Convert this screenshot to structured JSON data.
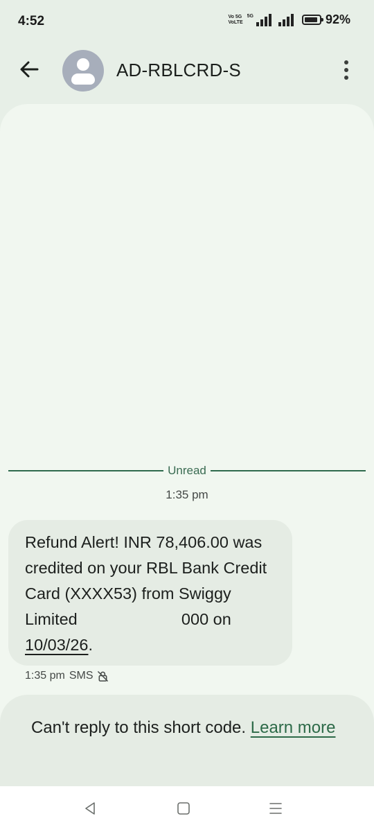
{
  "status_bar": {
    "time": "4:52",
    "volte_top": "Vo 5G",
    "volte_bottom": "VoLTE",
    "network": "5G",
    "battery_percent": "92%",
    "battery_level": 0.92
  },
  "header": {
    "contact_name": "AD-RBLCRD-S",
    "back_icon": "arrow-left-icon",
    "avatar_icon": "person-icon",
    "menu_icon": "more-vertical-icon"
  },
  "conversation": {
    "unread_label": "Unread",
    "timestamp": "1:35 pm",
    "message": {
      "line1": "Refund Alert! INR 78,406.00 was",
      "line2": "credited on your RBL Bank Credit",
      "line3": "Card (XXXX53) from Swiggy",
      "line4": "Limited                       000 on",
      "date": "10/03/26",
      "end": "."
    },
    "meta_time": "1:35 pm",
    "meta_type": "SMS",
    "meta_icon": "lock-off-icon"
  },
  "footer": {
    "text": "Can't reply to this short code.",
    "link": "Learn more"
  },
  "nav": {
    "back_icon": "triangle-back-icon",
    "home_icon": "square-home-icon",
    "recents_icon": "menu-lines-icon"
  },
  "colors": {
    "background": "#e7efe7",
    "sheet": "#f1f7f0",
    "bubble": "#e5ece4",
    "accent": "#2e6a4d"
  }
}
